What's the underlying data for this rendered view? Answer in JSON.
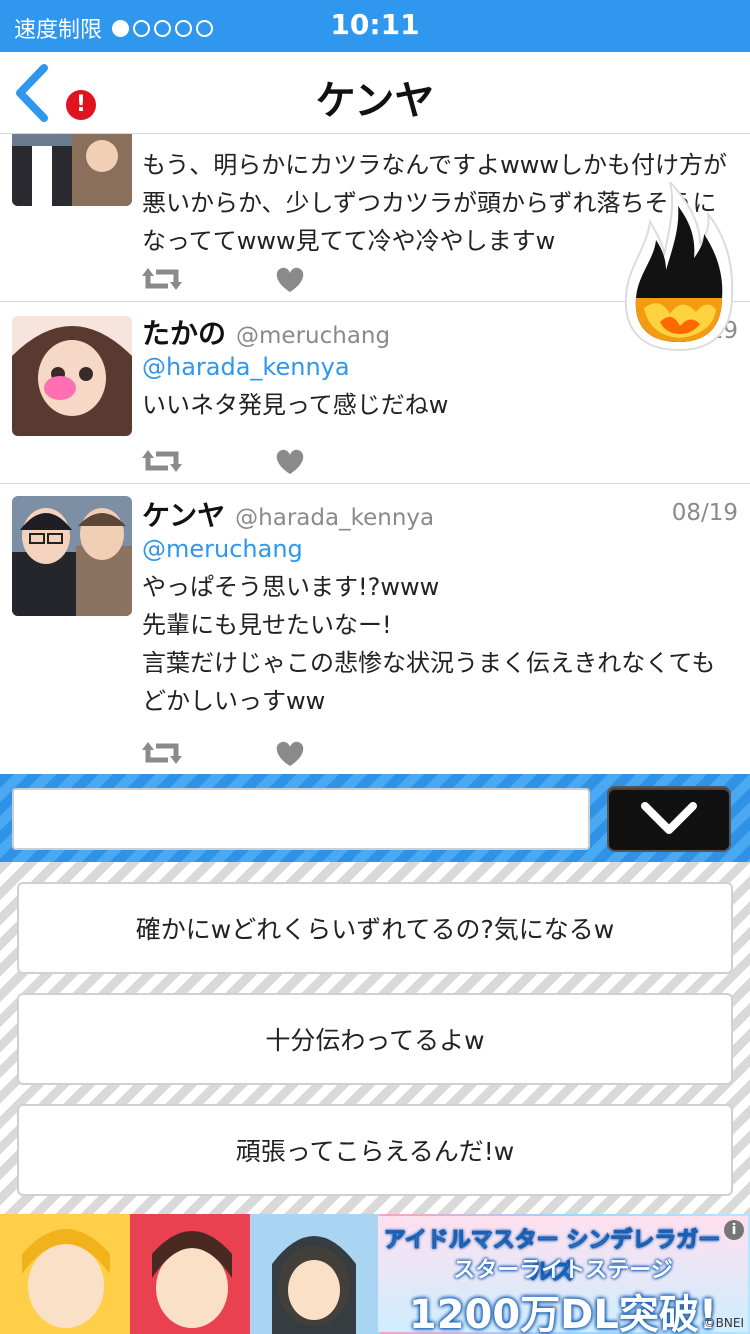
{
  "status_bar": {
    "carrier": "速度制限",
    "signal_strength": 1,
    "signal_total": 5,
    "time": "10:11"
  },
  "nav": {
    "title": "ケンヤ",
    "alert_badge": "!",
    "back_icon": "chevron-left-icon"
  },
  "tweets": [
    {
      "name": "",
      "handle": "",
      "date": "",
      "mention": "",
      "text": "もう、明らかにカツラなんですよwwwしかも付け方が悪いからか、少しずつカツラが頭からずれ落ちそうになっててwww見てて冷や冷やしますw"
    },
    {
      "name": "たかの",
      "handle": "@meruchang",
      "date": "08/19",
      "mention": "@harada_kennya",
      "text": "いいネタ発見って感じだねw"
    },
    {
      "name": "ケンヤ",
      "handle": "@harada_kennya",
      "date": "08/19",
      "mention": "@meruchang",
      "text": "やっぱそう思います!?www\n先輩にも見せたいなー!\n言葉だけじゃこの悲惨な状況うまく伝えきれなくてもどかしいっすww"
    }
  ],
  "reply": {
    "input_value": "",
    "collapse_icon": "chevron-down-icon"
  },
  "choices": [
    "確かにwどれくらいずれてるの?気になるw",
    "十分伝わってるよw",
    "頑張ってこらえるんだ!w"
  ],
  "ad": {
    "line1": "アイドルマスター シンデレラガールズ",
    "line2": "スターライトステージ",
    "line3": "1200万DL突破!",
    "info": "i",
    "copyright": "©BNEI"
  },
  "colors": {
    "accent_blue": "#2f97ee",
    "alert_red": "#e0141e"
  }
}
